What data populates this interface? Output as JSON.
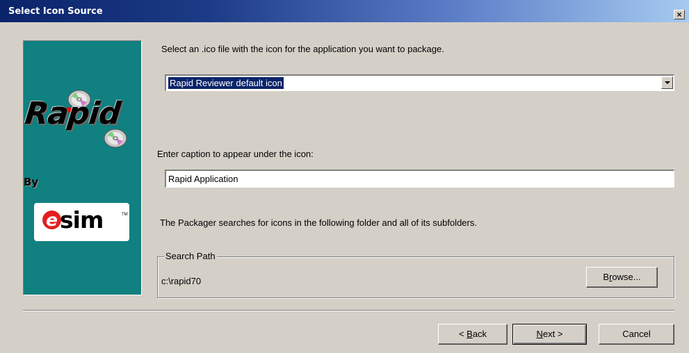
{
  "window": {
    "title": "Select Icon Source",
    "close_glyph": "×"
  },
  "banner": {
    "product": "Rapid",
    "by": "By",
    "logo_e": "e",
    "logo_sim": "sim",
    "logo_tm": "TM"
  },
  "icon_section": {
    "instruction": "Select an .ico file with the icon for the application you want to package.",
    "selected": "Rapid Reviewer default icon"
  },
  "caption_section": {
    "label": "Enter caption to appear under the icon:",
    "value": "Rapid Application"
  },
  "search": {
    "description": "The Packager searches for icons in the following folder and all of its subfolders.",
    "group_label": "Search Path",
    "path": "c:\\rapid70",
    "browse_pre": "B",
    "browse_u": "r",
    "browse_post": "owse..."
  },
  "buttons": {
    "back_pre": "< ",
    "back_u": "B",
    "back_post": "ack",
    "next_u": "N",
    "next_post": "ext >",
    "cancel": "Cancel"
  },
  "colors": {
    "title_gradient_start": "#0a246a",
    "banner_bg": "#108080",
    "dialog_bg": "#d4d0c8",
    "selection_bg": "#0a246a"
  }
}
